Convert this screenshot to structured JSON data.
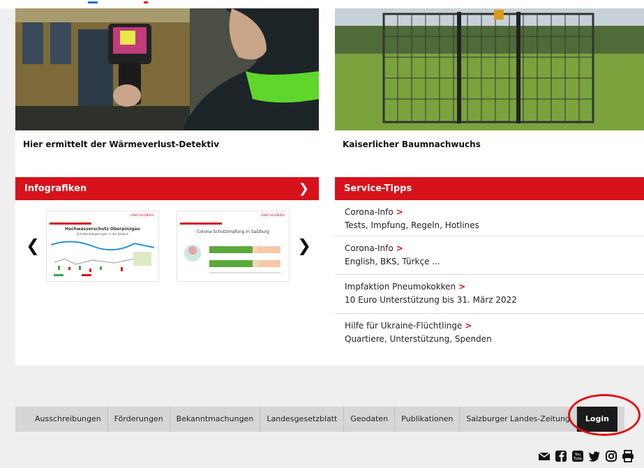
{
  "articles": [
    {
      "caption": "Hier ermittelt der Wärmeverlust-Detektiv"
    },
    {
      "caption": "Kaiserlicher Baumnachwuchs"
    }
  ],
  "infografiken": {
    "header": "Infografiken",
    "slides": [
      {
        "title": "Hochwasserschutz Oberpinzgau",
        "subtitle": "Schotterablagerungen in der Salzach",
        "logo": "LAND SALZBURG"
      },
      {
        "title": "Corona-Schutzimpfung in Salzburg",
        "subtitle": "",
        "logo": "LAND SALZBURG"
      }
    ]
  },
  "service": {
    "header": "Service-Tipps",
    "items": [
      {
        "title": "Corona-Info",
        "desc": "Tests, Impfung, Regeln, Hotlines"
      },
      {
        "title": "Corona-Info",
        "desc": "English, BKS, Türkçe ..."
      },
      {
        "title": "Impfaktion Pneumokokken",
        "desc": "10 Euro Unterstützung bis 31. März 2022"
      },
      {
        "title": "Hilfe für Ukraine-Flüchtlinge",
        "desc": "Quartiere, Unterstützung, Spenden"
      }
    ]
  },
  "footer_nav": [
    "Ausschreibungen",
    "Förderungen",
    "Bekanntmachungen",
    "Landesgesetzblatt",
    "Geodaten",
    "Publikationen",
    "Salzburger Landes-Zeitung"
  ],
  "login_label": "Login",
  "social_icons": [
    "mail-icon",
    "facebook-icon",
    "youtube-icon",
    "twitter-icon",
    "instagram-icon",
    "print-icon"
  ],
  "colors": {
    "accent": "#d7121b",
    "login_bg": "#1b1b1b",
    "highlight_circle": "#e31111"
  }
}
